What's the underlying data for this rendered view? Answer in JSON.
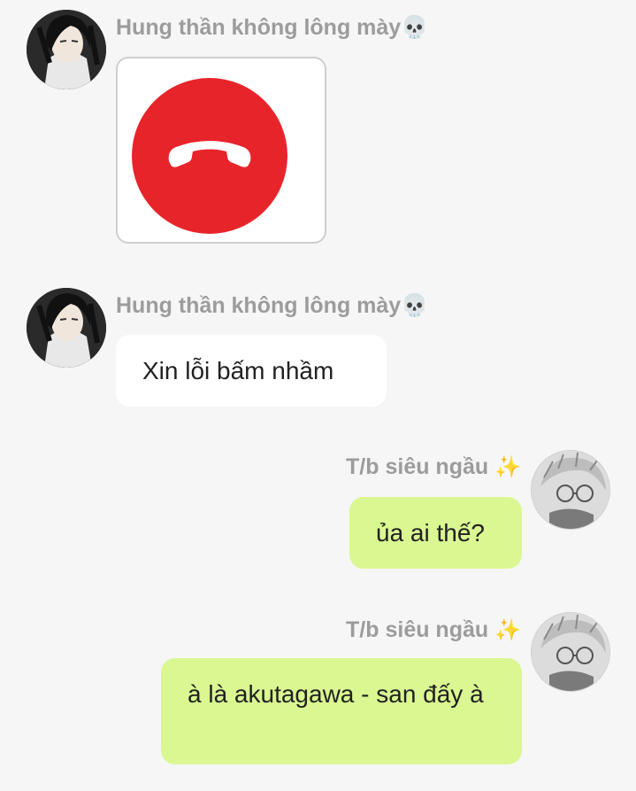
{
  "messages": [
    {
      "sender": "Hung thần không lông mày",
      "sender_emoji": "💀",
      "type": "call",
      "icon": "hangup-phone-icon",
      "accent": "#e8242b"
    },
    {
      "sender": "Hung thần không lông mày",
      "sender_emoji": "💀",
      "type": "text",
      "text": "Xin lỗi bấm nhầm"
    },
    {
      "sender": "T/b siêu ngầu",
      "sender_emoji": "✨",
      "type": "text",
      "text": "ủa ai thế?"
    },
    {
      "sender": "T/b siêu ngầu",
      "sender_emoji": "✨",
      "type": "text",
      "text": "à là akutagawa - san đấy à"
    }
  ],
  "colors": {
    "incoming_bubble": "#ffffff",
    "outgoing_bubble": "#daf792",
    "background": "#f6f6f6",
    "name": "#9c9c9c"
  }
}
